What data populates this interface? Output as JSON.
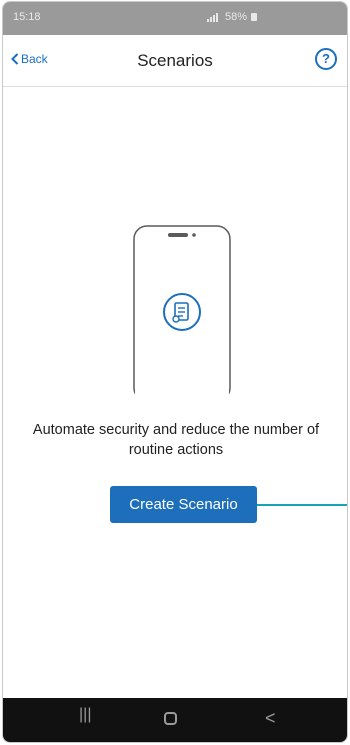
{
  "status_bar": {
    "time": "15:18",
    "signal_icon": "signal-icon",
    "battery_percent": "58%",
    "battery_icon": "battery-icon"
  },
  "header": {
    "back_label": "Back",
    "back_icon": "chevron-left-icon",
    "title": "Scenarios",
    "help_icon": "question-circle-icon",
    "help_glyph": "?"
  },
  "main": {
    "illustration_icon": "phone-scenario-icon",
    "message": "Automate security and reduce the number of routine actions",
    "create_button_label": "Create Scenario"
  },
  "colors": {
    "accent": "#1a6fc0",
    "button_bg": "#1d6fbb",
    "callout": "#17a2b8",
    "status_bar": "#9a9a9a",
    "nav_bar": "#111111"
  },
  "nav_bar": {
    "recents_glyph": "|||",
    "back_glyph": "<"
  }
}
